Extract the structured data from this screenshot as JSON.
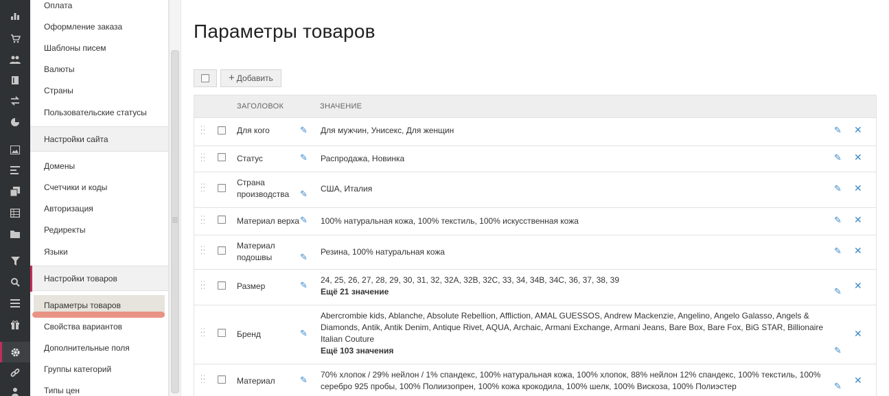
{
  "rail": {
    "icons": [
      "bar-chart-icon",
      "cart-icon",
      "users-icon",
      "book-icon",
      "exchange-icon",
      "pie-chart-icon",
      "image-icon",
      "align-left-icon",
      "copy-icon",
      "table-icon",
      "folder-icon",
      "filter-icon",
      "search-icon",
      "list-icon",
      "gift-icon",
      "gear-icon",
      "link-icon",
      "person-icon"
    ]
  },
  "menu": {
    "items_top": [
      "Оплата",
      "Оформление заказа",
      "Шаблоны писем",
      "Валюты",
      "Страны",
      "Пользовательские статусы"
    ],
    "section_site": "Настройки сайта",
    "items_site": [
      "Домены",
      "Счетчики и коды",
      "Авторизация",
      "Редиректы",
      "Языки"
    ],
    "section_products": "Настройки товаров",
    "items_products": [
      "Параметры товаров",
      "Свойства вариантов",
      "Дополнительные поля",
      "Группы категорий",
      "Типы цен"
    ]
  },
  "page": {
    "title": "Параметры товаров",
    "add_label": "Добавить"
  },
  "table": {
    "col_title": "ЗАГОЛОВОК",
    "col_value": "ЗНАЧЕНИЕ",
    "rows": [
      {
        "name": "Для кого",
        "value": "Для мужчин, Унисекс, Для женщин",
        "more": ""
      },
      {
        "name": "Статус",
        "value": "Распродажа, Новинка",
        "more": ""
      },
      {
        "name": "Страна производства",
        "value": "США, Италия",
        "more": ""
      },
      {
        "name": "Материал верха",
        "value": "100% натуральная кожа, 100% текстиль, 100% искусственная кожа",
        "more": ""
      },
      {
        "name": "Материал подошвы",
        "value": "Резина, 100% натуральная кожа",
        "more": ""
      },
      {
        "name": "Размер",
        "value": "24, 25, 26, 27, 28, 29, 30, 31, 32, 32A, 32B, 32C, 33, 34, 34B, 34C, 36, 37, 38, 39",
        "more": "Ещё 21 значение"
      },
      {
        "name": "Бренд",
        "value": "Abercrombie kids, Ablanche, Absolute Rebellion, Affliction, AMAL GUESSOS, Andrew Mackenzie, Angelino, Angelo Galasso, Angels & Diamonds, Antik, Antik Denim, Antique Rivet, AQUA, Archaic, Armani Exchange, Armani Jeans, Bare Box, Bare Fox, BiG STAR, Billionaire Italian Couture",
        "more": "Ещё 103 значения"
      },
      {
        "name": "Материал",
        "value": "70% хлопок / 29% нейлон / 1% спандекс, 100% натуральная кожа, 100% хлопок, 88% нейлон 12% спандекс, 100% текстиль, 100% серебро 925 пробы, 100% Полиизопрен, 100% кожа крокодила, 100% шелк, 100% Вискоза, 100% Полиэстер",
        "more": ""
      }
    ]
  }
}
